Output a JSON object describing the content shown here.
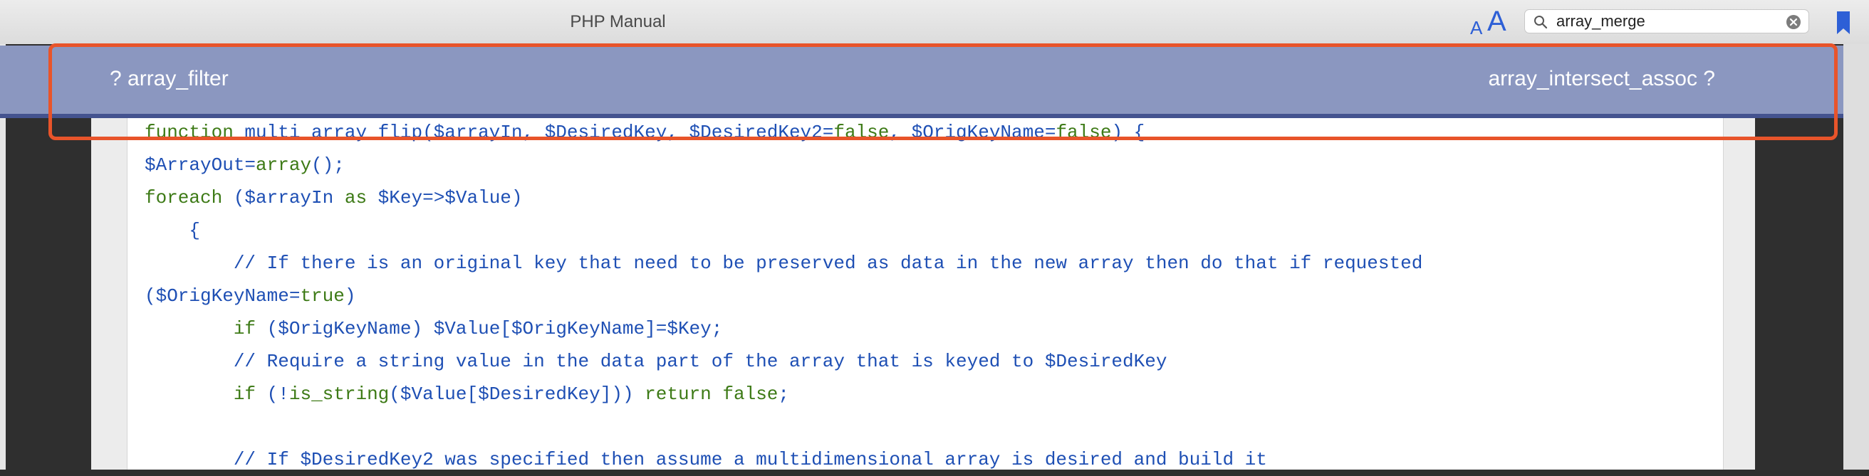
{
  "window": {
    "title": "PHP Manual"
  },
  "toolbar": {
    "font_small": "A",
    "font_large": "A"
  },
  "search": {
    "value": "array_merge",
    "placeholder": ""
  },
  "nav": {
    "prev_label": "? array_filter",
    "next_label": "array_intersect_assoc ?"
  },
  "code": {
    "lines": [
      "function multi_array_flip($arrayIn, $DesiredKey, $DesiredKey2=false, $OrigKeyName=false) {",
      "$ArrayOut=array();",
      "foreach ($arrayIn as $Key=>$Value)",
      "    {",
      "        // If there is an original key that need to be preserved as data in the new array then do that if requested",
      "($OrigKeyName=true)",
      "        if ($OrigKeyName) $Value[$OrigKeyName]=$Key;",
      "        // Require a string value in the data part of the array that is keyed to $DesiredKey",
      "        if (!is_string($Value[$DesiredKey])) return false;",
      "",
      "        // If $DesiredKey2 was specified then assume a multidimensional array is desired and build it"
    ]
  },
  "colors": {
    "nav_bar": "#8b97c0",
    "nav_border": "#44538f",
    "highlight": "#e8542a",
    "keyword": "#3d7a16",
    "variable": "#1e4fb4"
  }
}
